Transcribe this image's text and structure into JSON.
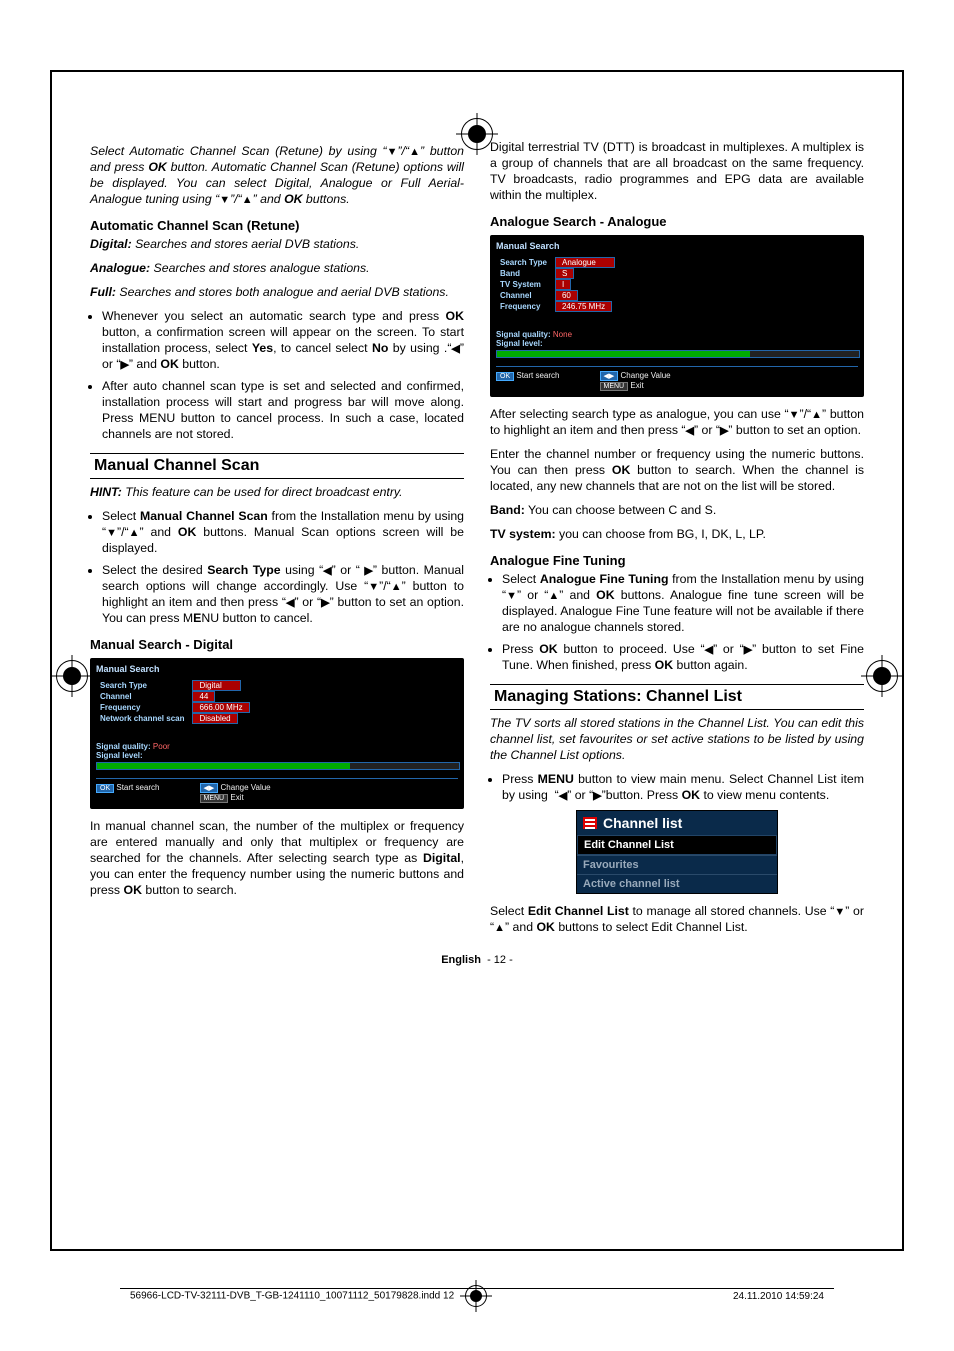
{
  "intro": "Select Automatic Channel Scan (Retune) by using \"▼\"/\"▲\" button and press OK button. Automatic Channel Scan (Retune) options will be displayed. You can select Digital, Analogue or Full Aerial-Analogue tuning using \"▼\"/\"▲\" and OK buttons.",
  "autoScan": {
    "heading": "Automatic Channel Scan (Retune)",
    "digitalLabel": "Digital:",
    "digitalText": " Searches and stores aerial DVB stations.",
    "analogueLabel": "Analogue:",
    "analogueText": " Searches and stores analogue stations.",
    "fullLabel": "Full:",
    "fullText": " Searches and stores both analogue and aerial DVB stations.",
    "bul1": "Whenever you select an automatic search type and press OK button, a confirmation screen will appear on the screen. To start installation process, select Yes, to cancel select No by using .\"◀\" or \"▶\" and OK button.",
    "bul2": "After auto channel scan type is set and selected and confirmed, installation process will start and progress bar will move along. Press MENU button to cancel process. In such a case, located channels are not stored."
  },
  "manualScan": {
    "heading": "Manual Channel Scan",
    "hint": "HINT: This feature can be used for direct broadcast entry.",
    "bul1": "Select Manual Channel Scan from the Installation menu by using \"▼\"/\"▲\" and OK buttons. Manual Scan options screen will be displayed.",
    "bul2": "Select the desired Search Type using \"◀\" or \" ▶\" button. Manual search options will change accordingly. Use \"▼\"/\"▲\" button to highlight an item and then press \"◀\" or \"▶\" button to set an option. You can press MENU button to cancel.",
    "digHeading": "Manual Search - Digital",
    "osd1": {
      "title": "Manual Search",
      "rows": [
        {
          "l": "Search Type",
          "v": "Digital",
          "wide": true
        },
        {
          "l": "Channel",
          "v": "44"
        },
        {
          "l": "Frequency",
          "v": "666.00 MHz"
        },
        {
          "l": "Network channel scan",
          "v": "Disabled"
        }
      ],
      "sigQ": "Signal quality:",
      "sigQV": "Poor",
      "sigL": "Signal level:",
      "footL": "Start search",
      "btnL": "OK",
      "footR": "Change Value",
      "btnR": "MENU",
      "footR2": "Exit"
    },
    "afterDig1": "In manual channel scan, the number of the multiplex or frequency are entered manually and only that multiplex or frequency are searched for the channels. After selecting search type as Digital, you can enter the frequency number using the numeric buttons and press OK button to search.",
    "afterDig2": "Digital terrestrial TV (DTT) is broadcast in multiplexes. A multiplex is a group of channels that are all broadcast on the same frequency. TV broadcasts, radio programmes and EPG data are available within the multiplex.",
    "anaHeading": "Analogue Search - Analogue",
    "osd2": {
      "title": "Manual Search",
      "rows": [
        {
          "l": "Search Type",
          "v": "Analogue",
          "wide": true
        },
        {
          "l": "Band",
          "v": "S"
        },
        {
          "l": "TV System",
          "v": "I"
        },
        {
          "l": "Channel",
          "v": "60"
        },
        {
          "l": "Frequency",
          "v": "246.75 MHz"
        }
      ],
      "sigQ": "Signal quality:",
      "sigQV": "None",
      "sigL": "Signal level:",
      "footL": "Start search",
      "btnL": "OK",
      "footR": "Change Value",
      "btnR": "MENU",
      "footR2": "Exit"
    },
    "afterAna1": "After selecting search type as analogue, you can use \"▼\"/\"▲\" button to highlight an item and then press \"◀\" or \"▶\" button to set an option.",
    "afterAna2": "Enter the channel number or frequency using the numeric buttons. You can then press OK button to search. When the channel is located, any new channels that are not on the list will be stored.",
    "band": "Band: You can choose between C and S.",
    "tvsys": "TV system: you can choose from BG, I, DK, L, LP.",
    "fineHeading": "Analogue Fine Tuning",
    "fine1": "Select Analogue Fine Tuning from the Installation menu by using \"▼\" or \"▲\" and OK buttons. Analogue fine tune screen will be displayed. Analogue Fine Tune feature will not be available if there are no analogue channels stored.",
    "fine2": "Press OK button to proceed. Use \"◀\" or \"▶\" button to set Fine Tune. When finished, press OK button again."
  },
  "stations": {
    "heading": "Managing Stations: Channel List",
    "intro": "The TV sorts all stored stations in the Channel List. You can edit this channel list, set favourites or set active stations to be listed by using the Channel List options.",
    "bul1": "Press MENU button to view main menu. Select Channel List item by using  \"◀\" or \"▶\"button. Press OK to view menu contents.",
    "list": {
      "title": "Channel list",
      "items": [
        "Edit Channel List",
        "Favourites",
        "Active channel list"
      ]
    },
    "after": "Select Edit Channel List to manage all stored channels. Use \"▼\" or \"▲\" and OK buttons to select Edit Channel List."
  },
  "footer": {
    "lang": "English",
    "page": "- 12 -",
    "file": "56966-LCD-TV-32111-DVB_T-GB-1241110_10071112_50179828.indd   12",
    "date": "24.11.2010   14:59:24"
  }
}
